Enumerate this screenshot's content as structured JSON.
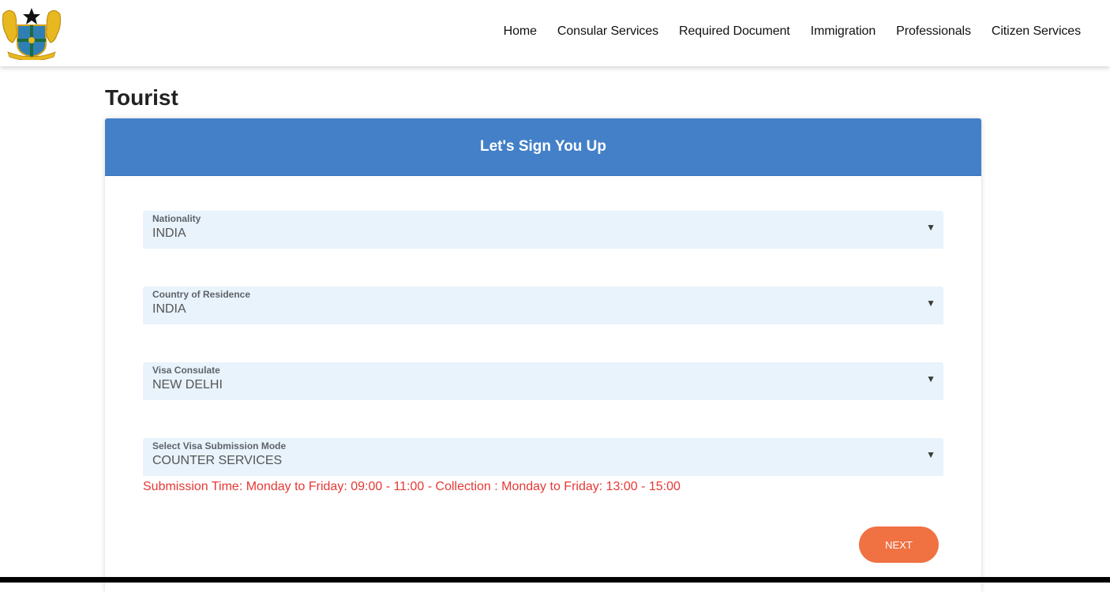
{
  "header": {
    "logo_alt": "Ghana Coat of Arms",
    "nav": [
      {
        "label": "Home"
      },
      {
        "label": "Consular Services"
      },
      {
        "label": "Required Document"
      },
      {
        "label": "Immigration"
      },
      {
        "label": "Professionals"
      },
      {
        "label": "Citizen Services"
      }
    ]
  },
  "page": {
    "title": "Tourist"
  },
  "form": {
    "header": "Let's Sign You Up",
    "fields": [
      {
        "label": "Nationality",
        "value": "INDIA"
      },
      {
        "label": "Country of Residence",
        "value": "INDIA"
      },
      {
        "label": "Visa Consulate",
        "value": "NEW DELHI"
      },
      {
        "label": "Select Visa Submission Mode",
        "value": "COUNTER SERVICES"
      }
    ],
    "dropdown_icon": "▼",
    "info_text": "Submission Time: Monday to Friday: 09:00 - 11:00 - Collection : Monday to Friday: 13:00 - 15:00",
    "next_label": "NEXT"
  },
  "colors": {
    "header_blue": "#4380c8",
    "field_bg": "#e8f3fc",
    "info_red": "#e53935",
    "button_orange": "#f07142"
  }
}
